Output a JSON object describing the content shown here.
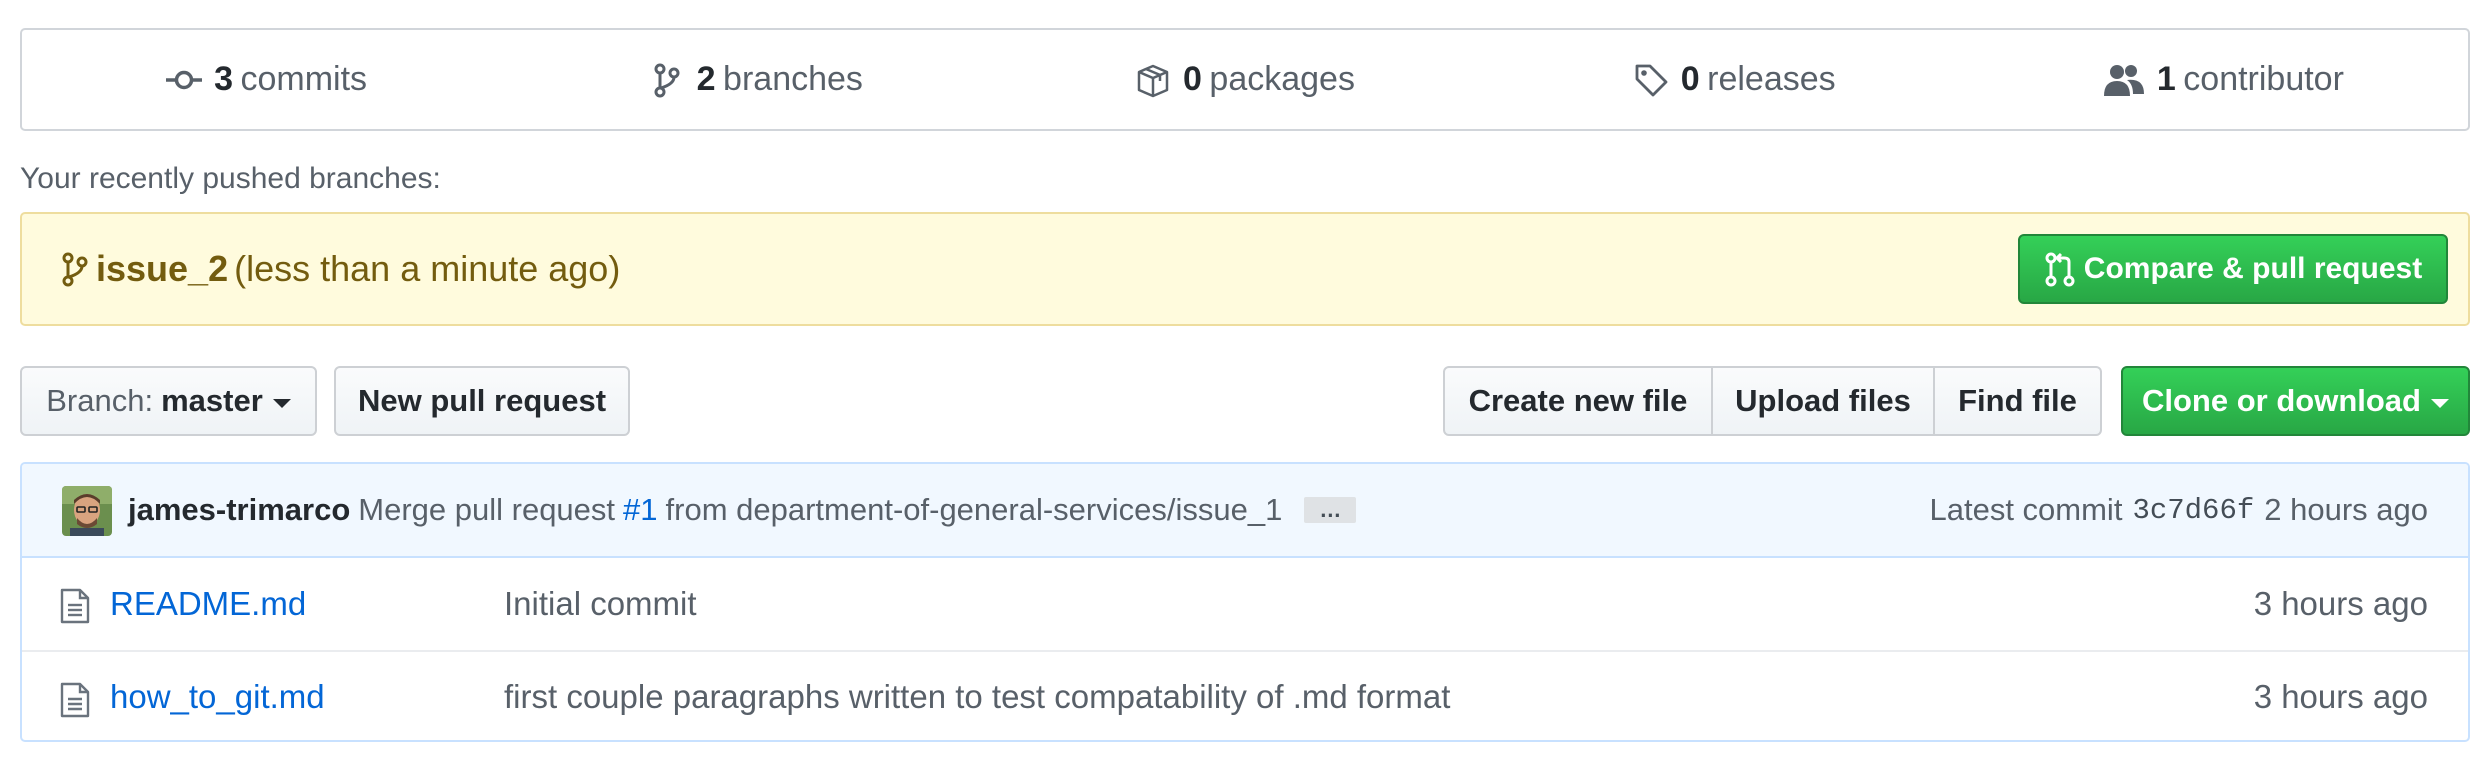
{
  "summary": {
    "commits": {
      "count": "3",
      "label": "commits",
      "icon": "commit-icon"
    },
    "branches": {
      "count": "2",
      "label": "branches",
      "icon": "branch-icon"
    },
    "packages": {
      "count": "0",
      "label": "packages",
      "icon": "package-icon"
    },
    "releases": {
      "count": "0",
      "label": "releases",
      "icon": "tag-icon"
    },
    "contributors": {
      "count": "1",
      "label": "contributor",
      "icon": "people-icon"
    }
  },
  "recent": {
    "label": "Your recently pushed branches:",
    "branch": "issue_2",
    "when": "(less than a minute ago)",
    "compare_label": "Compare & pull request"
  },
  "toolbar": {
    "branch_prefix": "Branch:",
    "branch_name": "master",
    "new_pr_label": "New pull request",
    "create_file_label": "Create new file",
    "upload_label": "Upload files",
    "find_file_label": "Find file",
    "clone_label": "Clone or download"
  },
  "commit": {
    "author": "james-trimarco",
    "message_prefix": "Merge pull request",
    "issue_ref": "#1",
    "message_suffix": "from department-of-general-services/issue_1",
    "ellipsis": "…",
    "latest_label": "Latest commit",
    "sha": "3c7d66f",
    "age": "2 hours ago"
  },
  "files": [
    {
      "name": "README.md",
      "message": "Initial commit",
      "age": "3 hours ago"
    },
    {
      "name": "how_to_git.md",
      "message": "first couple paragraphs written to test compatability of .md format",
      "age": "3 hours ago"
    }
  ],
  "colors": {
    "link": "#0366d6",
    "primary_green": "#28a745",
    "banner_bg": "#fffbdd",
    "banner_text": "#735c0f",
    "commit_bg": "#f1f8ff"
  }
}
